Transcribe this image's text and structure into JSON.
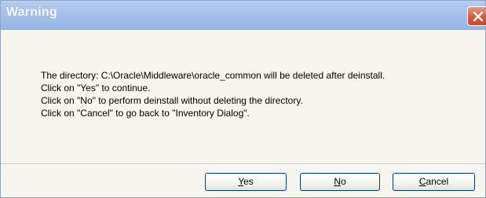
{
  "window": {
    "title": "Warning",
    "close_icon": "close-x-icon",
    "accent_color": "#d75a3c",
    "titlebar_color": "#a6c0ea"
  },
  "message": {
    "lines": [
      "The directory: C:\\Oracle\\Middleware\\oracle_common will be deleted after deinstall.",
      "Click on \"Yes\" to continue.",
      "Click on \"No\" to perform deinstall without deleting the directory.",
      "Click on \"Cancel\" to go back to \"Inventory Dialog\"."
    ]
  },
  "buttons": {
    "yes": {
      "mnemonic": "Y",
      "rest": "es"
    },
    "no": {
      "mnemonic": "N",
      "rest": "o"
    },
    "cancel": {
      "mnemonic": "C",
      "rest": "ancel"
    }
  }
}
